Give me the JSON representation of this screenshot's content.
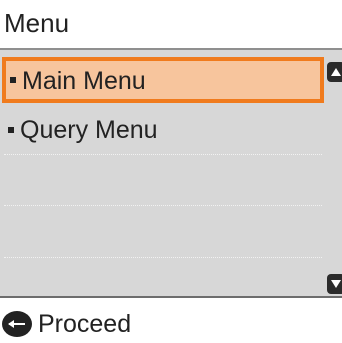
{
  "header": {
    "title": "Menu"
  },
  "menu": {
    "items": [
      {
        "label": "Main Menu",
        "selected": true
      },
      {
        "label": "Query Menu",
        "selected": false
      }
    ]
  },
  "footer": {
    "icon": "enter-icon",
    "label": "Proceed"
  },
  "colors": {
    "selected_fill": "#f7c59d",
    "selected_border": "#f07b1d",
    "list_background": "#d7d7d7"
  }
}
